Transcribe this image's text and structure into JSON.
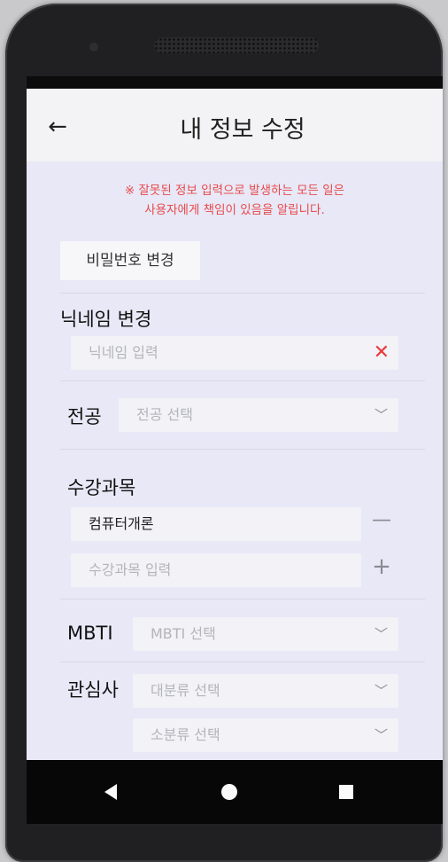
{
  "header": {
    "back_icon": "←",
    "title": "내 정보 수정"
  },
  "notice": {
    "line1": "※ 잘못된 정보 입력으로 발생하는 모든 일은",
    "line2": "사용자에게 책임이 있음을 알립니다."
  },
  "password": {
    "button_label": "비밀번호 변경"
  },
  "nickname": {
    "label": "닉네임 변경",
    "placeholder": "닉네임 입력",
    "clear_icon": "✕"
  },
  "major": {
    "label": "전공",
    "placeholder": "전공 선택",
    "chevron": "﹀"
  },
  "courses": {
    "label": "수강과목",
    "items": [
      {
        "value": "컴퓨터개론",
        "action_icon": "—"
      }
    ],
    "input_placeholder": "수강과목 입력",
    "add_icon": "+"
  },
  "mbti": {
    "label": "MBTI",
    "placeholder": "MBTI 선택",
    "chevron": "﹀"
  },
  "interests": {
    "label": "관심사",
    "major_placeholder": "대분류 선택",
    "minor_placeholder": "소분류 선택",
    "chevron": "﹀"
  },
  "colors": {
    "notice": "#e84a4a",
    "clear": "#ea3a3a",
    "screen_bg": "#e8e8f7"
  }
}
